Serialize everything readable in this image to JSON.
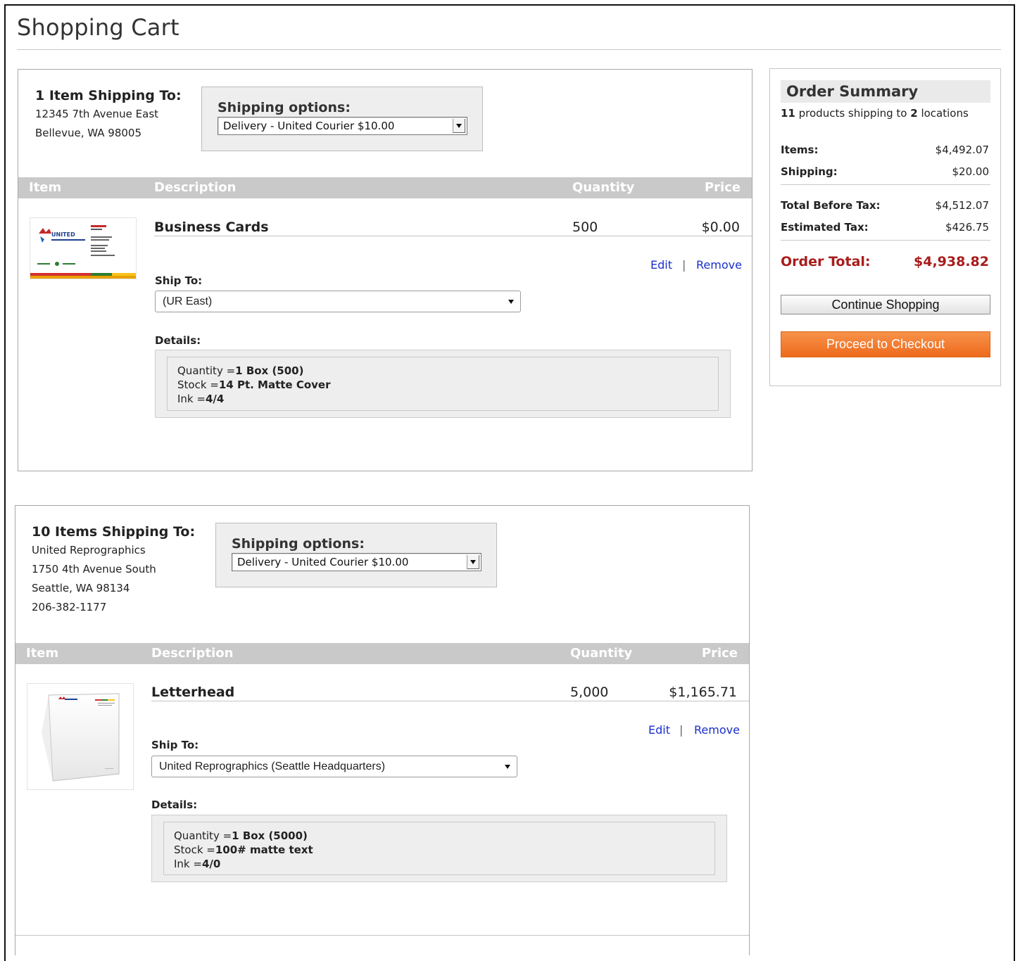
{
  "page": {
    "title": "Shopping Cart"
  },
  "column_headers": {
    "item": "Item",
    "description": "Description",
    "quantity": "Quantity",
    "price": "Price"
  },
  "shipments": [
    {
      "heading": "1 Item Shipping To:",
      "address": [
        "12345 7th Avenue East",
        "Bellevue, WA 98005"
      ],
      "shipping_options_label": "Shipping options:",
      "shipping_option_selected": "Delivery - United Courier $10.00",
      "product": {
        "name": "Business Cards",
        "quantity": "500",
        "price": "$0.00",
        "edit_label": "Edit",
        "remove_label": "Remove",
        "separator": "|",
        "ship_to_label": "Ship To:",
        "ship_to_selected": "(UR East)",
        "details_label": "Details:",
        "details": [
          {
            "key": "Quantity =",
            "value": "1 Box (500)"
          },
          {
            "key": "Stock =",
            "value": "14 Pt. Matte Cover"
          },
          {
            "key": "Ink =",
            "value": "4/4"
          }
        ]
      }
    },
    {
      "heading": "10 Items Shipping To:",
      "address": [
        "United Reprographics",
        "1750 4th Avenue South",
        "Seattle, WA 98134",
        "206-382-1177"
      ],
      "shipping_options_label": "Shipping options:",
      "shipping_option_selected": "Delivery - United Courier $10.00",
      "product": {
        "name": "Letterhead",
        "quantity": "5,000",
        "price": "$1,165.71",
        "edit_label": "Edit",
        "remove_label": "Remove",
        "separator": "|",
        "ship_to_label": "Ship To:",
        "ship_to_selected": "United Reprographics (Seattle Headquarters)",
        "details_label": "Details:",
        "details": [
          {
            "key": "Quantity =",
            "value": "1 Box (5000)"
          },
          {
            "key": "Stock =",
            "value": "100# matte text"
          },
          {
            "key": "Ink =",
            "value": "4/0"
          }
        ]
      }
    }
  ],
  "summary": {
    "title": "Order Summary",
    "subtitle_parts": [
      "11",
      " products shipping to ",
      "2",
      " locations"
    ],
    "items_label": "Items:",
    "items_value": "$4,492.07",
    "shipping_label": "Shipping:",
    "shipping_value": "$20.00",
    "before_tax_label": "Total Before Tax:",
    "before_tax_value": "$4,512.07",
    "tax_label": "Estimated Tax:",
    "tax_value": "$426.75",
    "total_label": "Order Total:",
    "total_value": "$4,938.82",
    "continue_label": "Continue Shopping",
    "checkout_label": "Proceed to Checkout"
  },
  "colors": {
    "header_gray": "#c9c9c9",
    "link_blue": "#1a2fcc",
    "total_red": "#a81c1c",
    "checkout_orange": "#ee6a1c"
  }
}
